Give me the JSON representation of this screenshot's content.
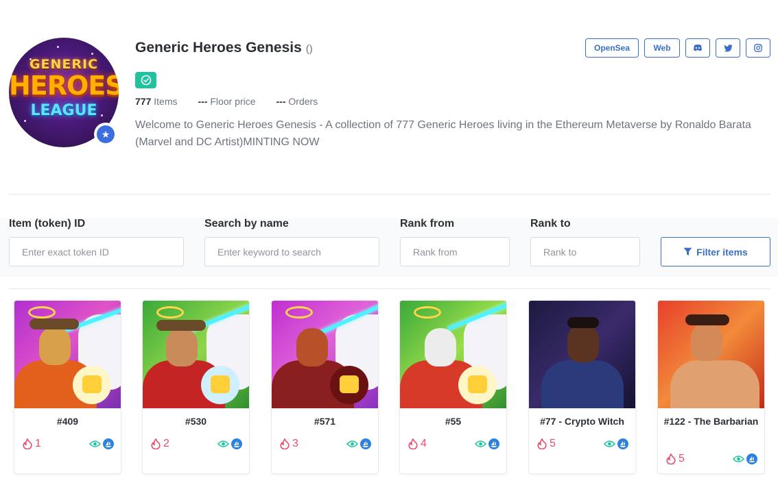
{
  "collection": {
    "title": "Generic Heroes Genesis",
    "title_suffix": "()",
    "avatar_text": {
      "line1": "GENERIC",
      "line2": "HEROES",
      "line3": "LEAGUE"
    },
    "stats": {
      "items_value": "777",
      "items_label": "Items",
      "floor_value": "---",
      "floor_label": "Floor price",
      "orders_value": "---",
      "orders_label": "Orders"
    },
    "description": "Welcome to Generic Heroes Genesis - A collection of 777 Generic Heroes living in the Ethereum Metaverse by Ronaldo Barata (Marvel and DC Artist)MINTING NOW"
  },
  "links": {
    "opensea": "OpenSea",
    "web": "Web",
    "icons": [
      "discord-icon",
      "twitter-icon",
      "instagram-icon"
    ]
  },
  "filters": {
    "token_label": "Item (token) ID",
    "token_placeholder": "Enter exact token ID",
    "name_label": "Search by name",
    "name_placeholder": "Enter keyword to search",
    "rank_from_label": "Rank from",
    "rank_from_placeholder": "Rank from",
    "rank_to_label": "Rank to",
    "rank_to_placeholder": "Rank to",
    "button": "Filter items"
  },
  "items": [
    {
      "name": "#409",
      "rank": "1"
    },
    {
      "name": "#530",
      "rank": "2"
    },
    {
      "name": "#571",
      "rank": "3"
    },
    {
      "name": "#55",
      "rank": "4"
    },
    {
      "name": "#77 - Crypto Witch",
      "rank": "5"
    },
    {
      "name": "#122 - The Barbarian",
      "rank": "5"
    }
  ],
  "colors": {
    "accent": "#3b6fc7",
    "verified": "#21c2a0",
    "rank": "#e94d6b",
    "eye": "#21c2a0",
    "opensea": "#2f81e0"
  }
}
